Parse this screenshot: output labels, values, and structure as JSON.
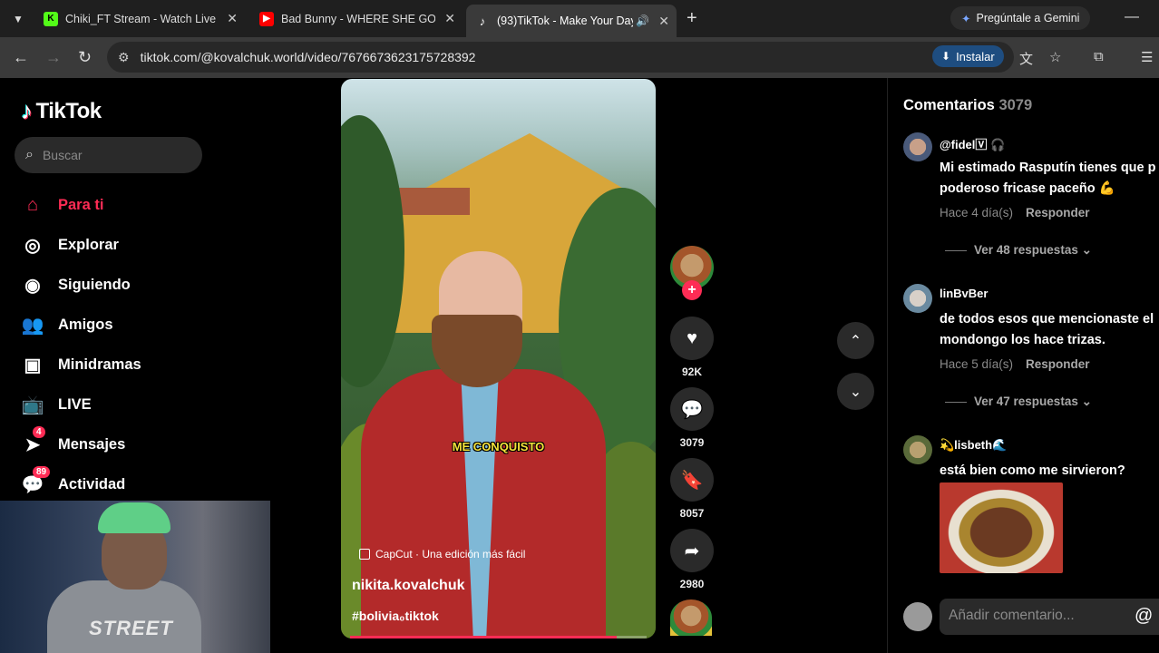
{
  "browser": {
    "tabs": [
      {
        "title": "Chiki_FT Stream - Watch Live o",
        "icon": "kick-icon",
        "color": "#53fc18"
      },
      {
        "title": "Bad Bunny - WHERE SHE GOES",
        "icon": "youtube-icon",
        "color": "#ff0000"
      },
      {
        "title": "(93)TikTok - Make Your Day",
        "icon": "tiktok-icon",
        "color": "#000000"
      }
    ],
    "gemini_label": "Pregúntale a Gemini",
    "url": "tiktok.com/@kovalchuk.world/video/7676673623175728392",
    "install_label": "Instalar"
  },
  "sidebar": {
    "logo": "TikTok",
    "search_placeholder": "Buscar",
    "items": [
      {
        "label": "Para ti",
        "icon": "home-icon",
        "active": true
      },
      {
        "label": "Explorar",
        "icon": "compass-icon"
      },
      {
        "label": "Siguiendo",
        "icon": "following-icon"
      },
      {
        "label": "Amigos",
        "icon": "friends-icon"
      },
      {
        "label": "Minidramas",
        "icon": "film-icon"
      },
      {
        "label": "LIVE",
        "icon": "live-icon"
      },
      {
        "label": "Mensajes",
        "icon": "messages-icon",
        "badge": "4"
      },
      {
        "label": "Actividad",
        "icon": "activity-icon",
        "badge": "89"
      }
    ]
  },
  "webcam": {
    "shirt_text": "STREET"
  },
  "video": {
    "caption": "ME CONQUISTO",
    "capcut": "CapCut · Una edición más fácil",
    "author": "nikita.kovalchuk",
    "hashtag": "#bolivia₀tiktok",
    "progress": 0.9
  },
  "actions": {
    "likes": "92K",
    "comments": "3079",
    "saves": "8057",
    "shares": "2980"
  },
  "comments": {
    "title": "Comentarios",
    "count": "3079",
    "items": [
      {
        "user": "@fidel🅅 🎧",
        "text1": "Mi estimado Rasputín tienes que p",
        "text2": "poderoso fricase paceño 💪",
        "time": "Hace 4 día(s)",
        "reply": "Responder",
        "more": "Ver 48 respuestas"
      },
      {
        "user": "linBvBer",
        "text1": "de todos esos que mencionaste el",
        "text2": "mondongo los hace trizas.",
        "time": "Hace 5 día(s)",
        "reply": "Responder",
        "more": "Ver 47 respuestas"
      },
      {
        "user": "💫lisbeth🌊",
        "text1": "está bien como me sirvieron?"
      }
    ],
    "input_placeholder": "Añadir comentario..."
  }
}
